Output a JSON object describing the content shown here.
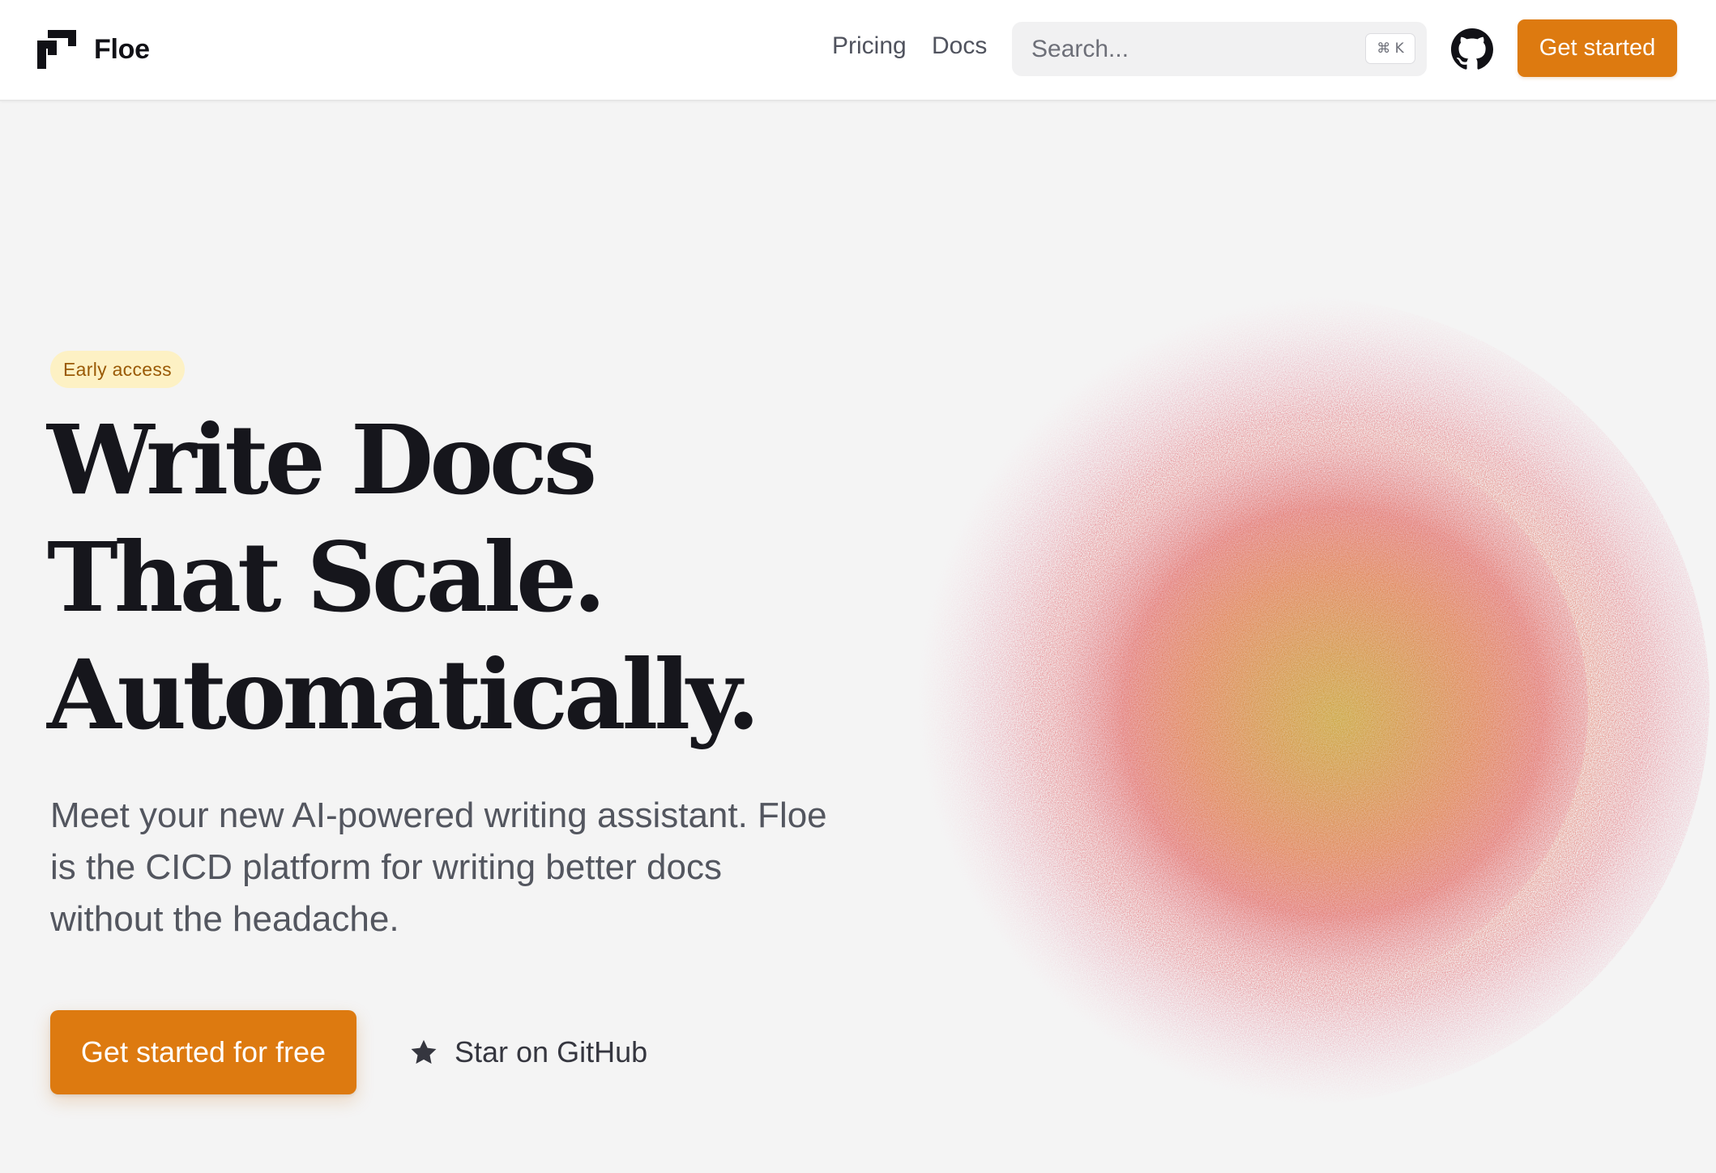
{
  "header": {
    "brand_name": "Floe",
    "nav": {
      "pricing": "Pricing",
      "docs": "Docs"
    },
    "search": {
      "placeholder": "Search...",
      "shortcut": "⌘ K"
    },
    "github_icon": "github-icon",
    "cta_label": "Get started"
  },
  "hero": {
    "badge": "Early access",
    "headline": [
      "Write Docs",
      "That Scale.",
      "Automatically."
    ],
    "subtext": "Meet your new AI-powered writing assistant. Floe is the CICD platform for writing better docs without the headache.",
    "primary_cta": "Get started for free",
    "secondary_cta": "Star on GitHub",
    "secondary_cta_icon": "star-icon"
  },
  "colors": {
    "accent": "#dd7a10",
    "badge_bg": "#fdf1c4",
    "badge_text": "#9a5a06",
    "page_bg": "#f4f4f4"
  }
}
